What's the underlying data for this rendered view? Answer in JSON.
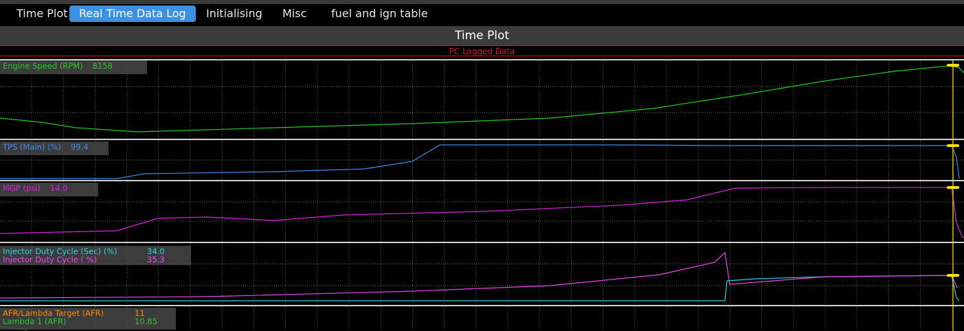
{
  "tabs": [
    {
      "label": "Time Plot",
      "active": false
    },
    {
      "label": "Real Time Data Log",
      "active": true
    },
    {
      "label": "Initialising",
      "active": false
    },
    {
      "label": "Misc",
      "active": false
    },
    {
      "label": "fuel and ign table",
      "active": false
    }
  ],
  "header": {
    "title": "Time Plot",
    "subtitle": "PC Logged Data"
  },
  "panels": [
    {
      "id": "rpm",
      "channels": [
        {
          "name": "Engine Speed (RPM)",
          "value": "8158",
          "color": "#22cc22"
        }
      ]
    },
    {
      "id": "tps",
      "channels": [
        {
          "name": "TPS (Main) (%)",
          "value": "99.4",
          "color": "#3a8cf0"
        }
      ]
    },
    {
      "id": "mgp",
      "channels": [
        {
          "name": "MGP (psi)",
          "value": "14.0",
          "color": "#dd22dd"
        }
      ]
    },
    {
      "id": "inj",
      "channels": [
        {
          "name": "Injector Duty Cycle (Sec) (%)",
          "value": "34.0",
          "color": "#22d8e0"
        },
        {
          "name": "Injector Duty Cycle ( %)",
          "value": "35.3",
          "color": "#ee44ee"
        }
      ]
    },
    {
      "id": "afr",
      "channels": [
        {
          "name": "AFR/Lambda Target (AFR)",
          "value": "11",
          "color": "#ff8a00"
        },
        {
          "name": "Lambda 1 (AFR)",
          "value": "10.85",
          "color": "#22cc22"
        }
      ]
    }
  ],
  "colors": {
    "cursor": "#ffe400",
    "grid": "#6a6a6a",
    "accent_tab": "#3d8fe0",
    "subheader": "#e01010"
  }
}
